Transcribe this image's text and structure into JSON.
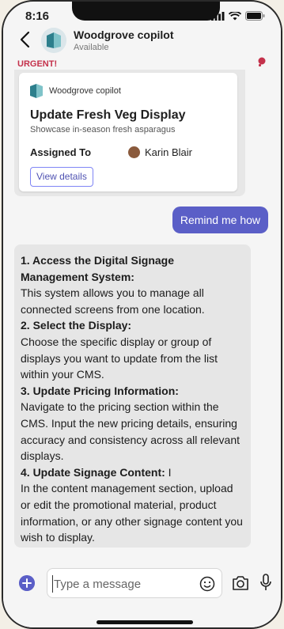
{
  "status_bar": {
    "time": "8:16"
  },
  "header": {
    "title": "Woodgrove copilot",
    "subtitle": "Available"
  },
  "card": {
    "urgent_label": "URGENT!",
    "app_name": "Woodgrove copilot",
    "title": "Update Fresh Veg Display",
    "subtitle": "Showcase in-season fresh asparagus",
    "assigned_label": "Assigned To",
    "assignee": "Karin Blair",
    "view_button": "View details"
  },
  "user_message": "Remind me how",
  "bot_message": {
    "steps": [
      {
        "title": "1. Access the Digital Signage Management System:",
        "body": "This system allows you to manage all connected screens from one location."
      },
      {
        "title": "2. Select the Display:",
        "body": "Choose the specific display or group of displays you want to update from the list within your CMS."
      },
      {
        "title": "3. Update Pricing Information:",
        "body": "Navigate to the pricing section within the CMS. Input the new pricing details, ensuring accuracy and consistency across all relevant displays."
      },
      {
        "title": "4. Update Signage Content:",
        "suffix": " I",
        "body": "In the content management section, upload or edit the promotional material, product information, or any other signage content you wish to display."
      }
    ]
  },
  "composer": {
    "placeholder": "Type a message"
  },
  "colors": {
    "accent": "#5b5fc7",
    "urgent": "#c4314b"
  },
  "icons": [
    "back-arrow-icon",
    "signal-icon",
    "wifi-icon",
    "battery-icon",
    "app-logo-icon",
    "plus-icon",
    "emoji-icon",
    "camera-icon",
    "mic-icon"
  ]
}
